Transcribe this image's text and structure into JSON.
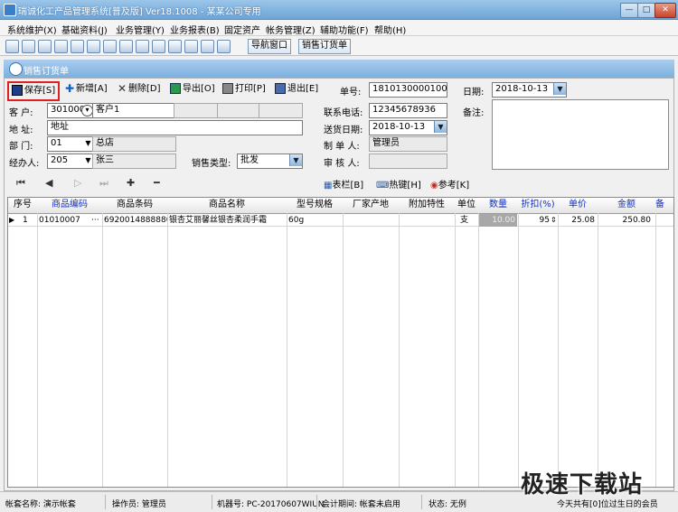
{
  "window": {
    "title": "瑞诚化工产品管理系统[普及版] Ver18.1008 - 某某公司专用",
    "min": "—",
    "max": "□",
    "close": "✕"
  },
  "menu": [
    "系统维护(X)",
    "基础资料(J)",
    "业务管理(Y)",
    "业务报表(B)",
    "固定资产",
    "帐务管理(Z)",
    "辅助功能(F)",
    "帮助(H)"
  ],
  "quick": {
    "nav_window": "导航窗口",
    "sales_order": "销售订货单"
  },
  "doc": {
    "title": "销售订货单"
  },
  "toolbar": {
    "save": "保存[S]",
    "add": "新增[A]",
    "delete": "删除[D]",
    "export": "导出[O]",
    "print": "打印[P]",
    "exit": "退出[E]"
  },
  "header": {
    "order_no_label": "单号:",
    "order_no": "181013000010001",
    "date_label": "日期:",
    "date": "2018-10-13",
    "customer_label": "客  户:",
    "customer_code": "3010001",
    "customer_name": "客户1",
    "address_label": "地  址:",
    "address": "地址",
    "dept_label": "部  门:",
    "dept_code": "01",
    "dept_name": "总店",
    "handler_label": "经办人:",
    "handler_code": "205",
    "handler_name": "张三",
    "sales_type_label": "销售类型:",
    "sales_type": "批发",
    "phone_label": "联系电话:",
    "phone": "12345678936",
    "delivery_label": "送货日期:",
    "delivery": "2018-10-13",
    "maker_label": "制 单 人:",
    "maker": "管理员",
    "auditor_label": "审 核 人:",
    "auditor": "",
    "remarks_label": "备注:"
  },
  "grid_toolbar": {
    "columns": "表栏[B]",
    "hotkey": "热键[H]",
    "reference": "参考[K]"
  },
  "grid": {
    "columns": [
      "序号",
      "商品编码",
      "商品条码",
      "商品名称",
      "型号规格",
      "厂家产地",
      "附加特性",
      "单位",
      "数量",
      "折扣(%)",
      "单价",
      "金额",
      "备"
    ],
    "rows": [
      {
        "seq": "1",
        "code": "01010007",
        "more": "···",
        "barcode": "6920014888880",
        "name": "银杏艾丽馨丝银杏柔润手霜",
        "spec": "60g",
        "maker": "",
        "extra": "",
        "unit": "支",
        "qty": "10.00",
        "discount": "95",
        "price": "25.08",
        "amount": "250.80"
      }
    ]
  },
  "status": {
    "account": "帐套名称: 演示帐套",
    "operator": "操作员: 管理员",
    "machine": "机器号: PC-20170607WIUN",
    "period": "会计期间: 帐套未启用",
    "state": "状态: 无例",
    "birthday": "今天共有[0]位过生日的会员"
  },
  "watermark": "极速下载站"
}
